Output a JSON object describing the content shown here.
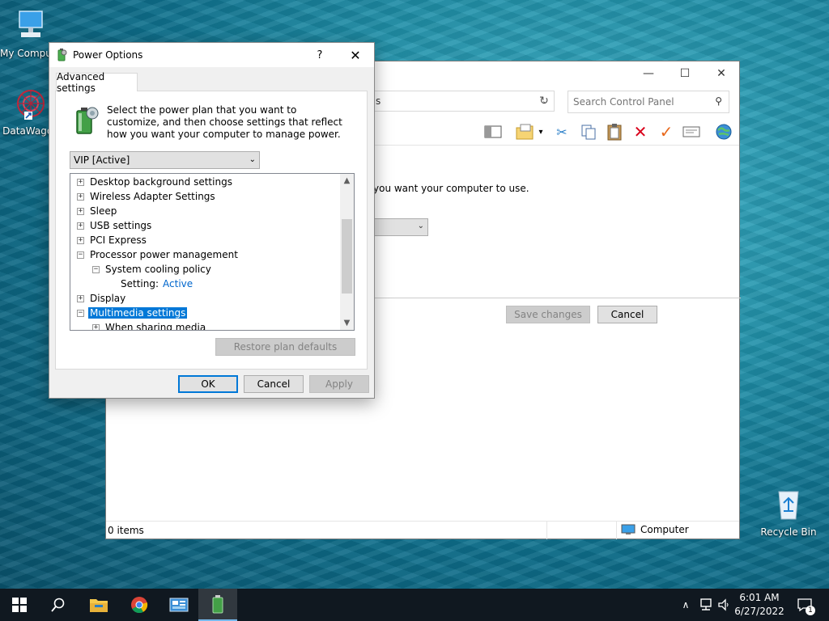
{
  "desktop": {
    "icons": [
      {
        "label": "My Computer"
      },
      {
        "label": "DataWagon"
      },
      {
        "label": "Recycle Bin"
      }
    ]
  },
  "explorer": {
    "address_text": "s",
    "search_placeholder": "Search Control Panel",
    "description": "you want your computer to use.",
    "save_label": "Save changes",
    "cancel_label": "Cancel",
    "status_items": "0 items",
    "status_location": "Computer"
  },
  "dialog": {
    "title": "Power Options",
    "help_glyph": "?",
    "close_glyph": "✕",
    "tab_label": "Advanced settings",
    "intro": "Select the power plan that you want to customize, and then choose settings that reflect how you want your computer to manage power.",
    "plan_value": "VIP [Active]",
    "tree": [
      {
        "label": "Desktop background settings",
        "expander": "+",
        "level": 0
      },
      {
        "label": "Wireless Adapter Settings",
        "expander": "+",
        "level": 0
      },
      {
        "label": "Sleep",
        "expander": "+",
        "level": 0
      },
      {
        "label": "USB settings",
        "expander": "+",
        "level": 0
      },
      {
        "label": "PCI Express",
        "expander": "+",
        "level": 0
      },
      {
        "label": "Processor power management",
        "expander": "−",
        "level": 0
      },
      {
        "label": "System cooling policy",
        "expander": "−",
        "level": 1
      },
      {
        "label": "Setting:",
        "value": "Active",
        "level": 2
      },
      {
        "label": "Display",
        "expander": "+",
        "level": 0
      },
      {
        "label": "Multimedia settings",
        "expander": "−",
        "level": 0,
        "selected": true
      },
      {
        "label": "When sharing media",
        "expander": "+",
        "level": 1
      }
    ],
    "restore_label": "Restore plan defaults",
    "ok_label": "OK",
    "cancel_label": "Cancel",
    "apply_label": "Apply"
  },
  "taskbar": {
    "time": "6:01 AM",
    "date": "6/27/2022",
    "notification_count": "1"
  },
  "colors": {
    "accent": "#0078d7",
    "setting_value": "#0066cc",
    "taskbar": "#101820"
  }
}
